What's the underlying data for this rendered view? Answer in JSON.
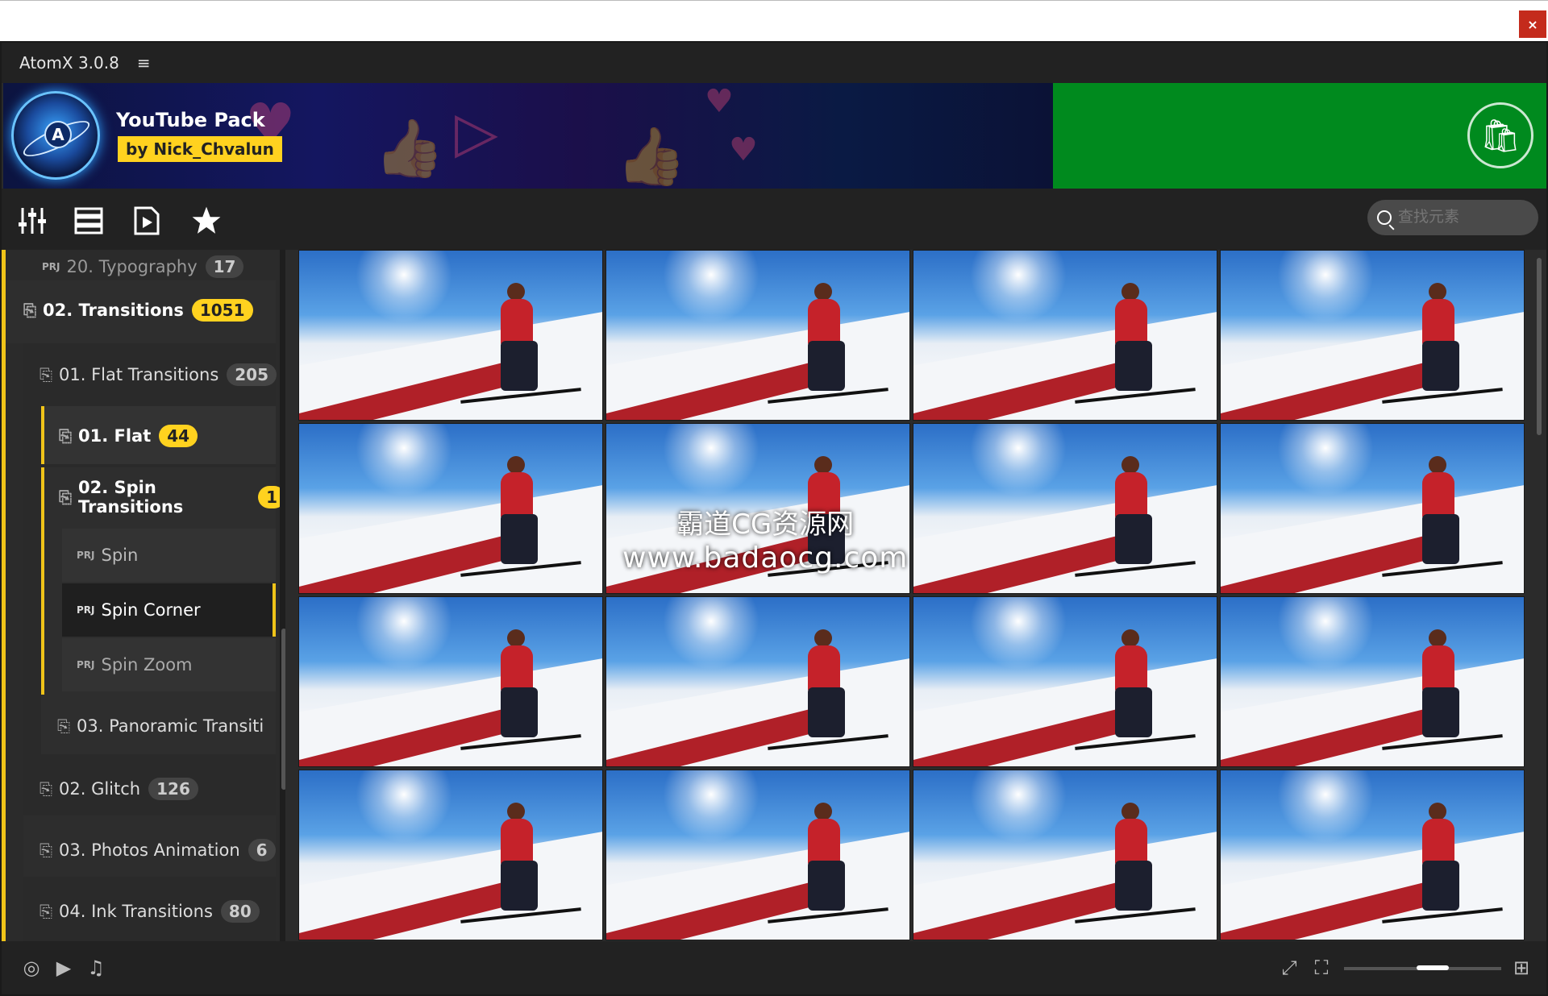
{
  "window": {
    "close_label": "×"
  },
  "app": {
    "title": "AtomX 3.0.8",
    "menu_icon": "≡"
  },
  "banner": {
    "pack_title": "YouTube Pack",
    "by": "by",
    "author": "Nick_Chvalun"
  },
  "toolbar": {
    "icons": [
      "sliders-icon",
      "list-icon",
      "video-file-icon",
      "star-icon"
    ],
    "search_placeholder": "查找元素"
  },
  "sidebar": {
    "items": [
      {
        "label": "20. Typography",
        "count": "17"
      },
      {
        "label": "02. Transitions",
        "count": "1051"
      },
      {
        "label": "01. Flat Transitions",
        "count": "205"
      },
      {
        "label": "01. Flat",
        "count": "44"
      },
      {
        "label": "02. Spin Transitions",
        "count": "1"
      },
      {
        "label": "Spin"
      },
      {
        "label": "Spin Corner"
      },
      {
        "label": "Spin Zoom"
      },
      {
        "label": "03. Panoramic Transiti"
      },
      {
        "label": "02. Glitch",
        "count": "126"
      },
      {
        "label": "03. Photos Animation",
        "count": "6"
      },
      {
        "label": "04. Ink Transitions",
        "count": "80"
      }
    ]
  },
  "watermark": {
    "line1": "霸道CG资源网",
    "line2": "www.badaocg.com"
  },
  "footer": {
    "icons": [
      "target-icon",
      "play-icon",
      "music-icon",
      "expand-icon",
      "fullscreen-icon",
      "grid-size-icon"
    ]
  },
  "colors": {
    "accent": "#ffd21f",
    "banner_green": "#008a1e",
    "close": "#c42b1c"
  }
}
